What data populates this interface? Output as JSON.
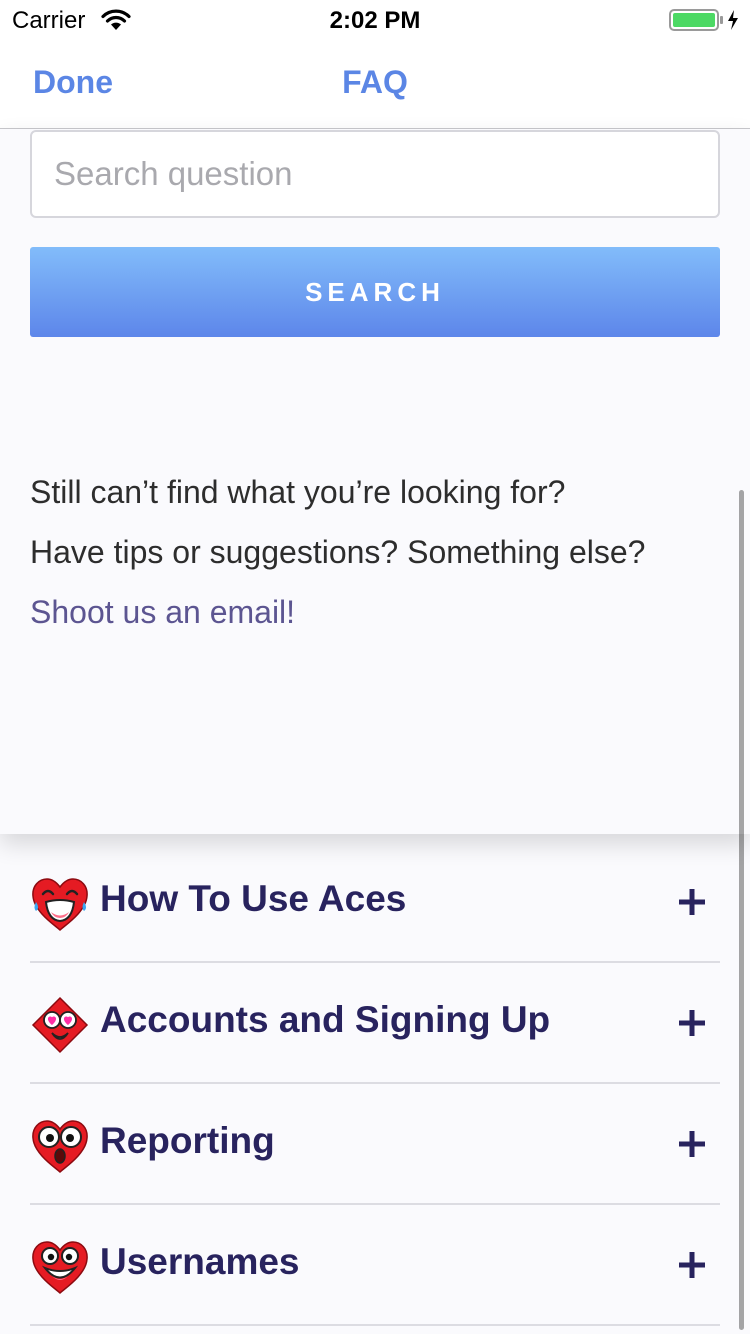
{
  "status_bar": {
    "carrier": "Carrier",
    "time": "2:02 PM",
    "wifi_icon": "wifi-icon",
    "battery_icon": "battery-charging-icon",
    "battery_color": "#4cd964"
  },
  "nav": {
    "done_label": "Done",
    "title": "FAQ",
    "accent_color": "#5b86e5"
  },
  "search": {
    "placeholder": "Search question",
    "value": "",
    "button_label": "SEARCH"
  },
  "help": {
    "line1": "Still can’t find what you’re looking for?",
    "line2": "Have tips or suggestions? Something else?",
    "email_link": "Shoot us an email!"
  },
  "faq": {
    "items": [
      {
        "label": "How To Use Aces",
        "icon": "laughing-heart-icon",
        "action_icon": "plus-icon"
      },
      {
        "label": "Accounts and Signing Up",
        "icon": "heart-eyes-diamond-icon",
        "action_icon": "plus-icon"
      },
      {
        "label": "Reporting",
        "icon": "surprised-heart-icon",
        "action_icon": "plus-icon"
      },
      {
        "label": "Usernames",
        "icon": "smiling-heart-icon",
        "action_icon": "plus-icon"
      }
    ]
  }
}
